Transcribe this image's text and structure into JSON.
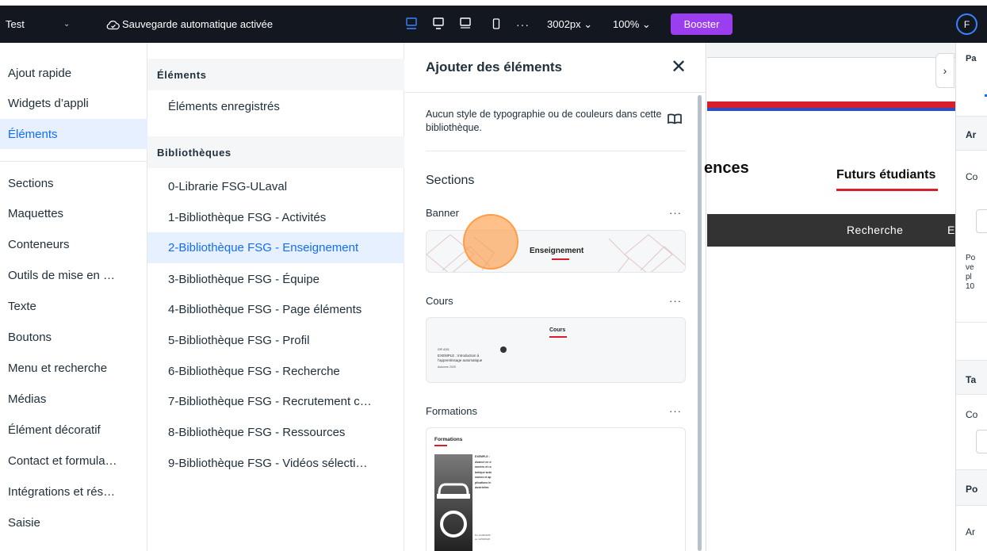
{
  "topbar": {
    "site_name": "Test",
    "site_chevron": "⌄",
    "autosave": "Sauvegarde automatique activée",
    "more": "···",
    "width": "3002px ⌄",
    "zoom": "100% ⌄",
    "boost": "Booster",
    "avatar": "F"
  },
  "categories": {
    "items": [
      "Ajout rapide",
      "Widgets d’appli",
      "Éléments",
      "Sections",
      "Maquettes",
      "Conteneurs",
      "Outils de mise en …",
      "Texte",
      "Boutons",
      "Menu et recherche",
      "Médias",
      "Élément décoratif",
      "Contact et formula…",
      "Intégrations et rés…",
      "Saisie"
    ],
    "active": "Éléments"
  },
  "library_menu": {
    "elements_header": "Éléments",
    "saved": "Éléments enregistrés",
    "libraries_header": "Bibliothèques",
    "libraries": [
      "0-Librarie FSG-ULaval",
      "1-Bibliothèque FSG - Activités",
      "2-Bibliothèque FSG - Enseignement",
      "3-Bibliothèque FSG - Équipe",
      "4-Bibliothèque FSG - Page éléments",
      "5-Bibliothèque FSG - Profil",
      "6-Bibliothèque FSG - Recherche",
      "7-Bibliothèque FSG - Recrutement c…",
      "8-Bibliothèque FSG - Ressources",
      "9-Bibliothèque FSG - Vidéos sélecti…"
    ],
    "active": "2-Bibliothèque FSG - Enseignement"
  },
  "panel": {
    "title": "Ajouter des éléments",
    "close": "✕",
    "empty_note": "Aucun style de typographie ou de couleurs dans cette bibliothèque.",
    "sections_label": "Sections",
    "banner": {
      "label": "Banner",
      "more": "···",
      "preview_title": "Enseignement"
    },
    "cours": {
      "label": "Cours",
      "more": "···",
      "preview_title": "Cours",
      "preview_code": "GIF-4101",
      "preview_desc": "EXEMPLE : Introduction à l’apprentissage automatique",
      "preview_date": "Automne 2025"
    },
    "formations": {
      "label": "Formations",
      "more": "···",
      "preview_title": "Formations",
      "preview_text": "EXEMPLE : Avancé en données et robotique autonomes et applications industrielles",
      "preview_price": "Du 12/09/2025 au 12/09/2026"
    }
  },
  "canvas": {
    "site_title": "ences",
    "nav_active": "Futurs étudiants",
    "nav_items": [
      "Recherche",
      "E"
    ],
    "expand": "›"
  },
  "right_panel": {
    "texts": [
      "Pa",
      "Ar",
      "Co",
      "Po",
      "ve",
      "pl",
      "10",
      "Ta",
      "Co",
      "Po",
      "Ar"
    ]
  },
  "colors": {
    "topbar_bg": "#131720",
    "accent": "#116dff",
    "active_bg": "#e7f0ff",
    "boost": "#9b3ef0",
    "brand_red": "#d61f2a"
  },
  "icons": {
    "cloud": "cloud-check-icon",
    "desktop": "desktop-icon",
    "laptop": "laptop-icon",
    "tablet": "tablet-icon",
    "mobile": "mobile-icon",
    "book": "book-icon",
    "close": "close-icon",
    "expand": "chevron-right-icon"
  }
}
